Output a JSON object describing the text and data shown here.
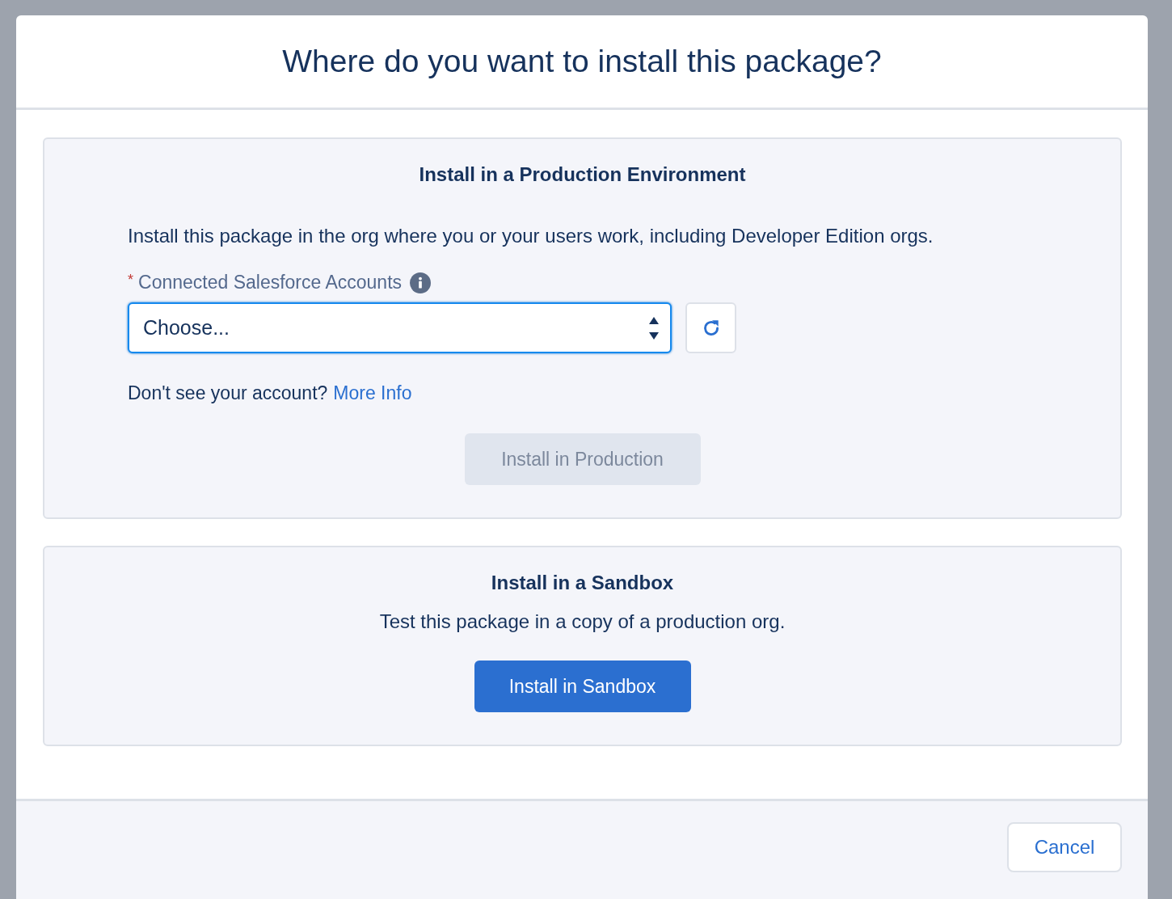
{
  "modal": {
    "title": "Where do you want to install this package?"
  },
  "production": {
    "title": "Install in a Production Environment",
    "description": "Install this package in the org where you or your users work, including Developer Edition orgs.",
    "field": {
      "required_mark": "*",
      "label": "Connected Salesforce Accounts",
      "value": "Choose...",
      "focused": true
    },
    "help_text": "Don't see your account?",
    "help_link": "More Info",
    "button": {
      "label": "Install in Production",
      "disabled": true
    }
  },
  "sandbox": {
    "title": "Install in a Sandbox",
    "description": "Test this package in a copy of a production org.",
    "button": {
      "label": "Install in Sandbox",
      "disabled": false
    }
  },
  "footer": {
    "cancel": "Cancel"
  }
}
